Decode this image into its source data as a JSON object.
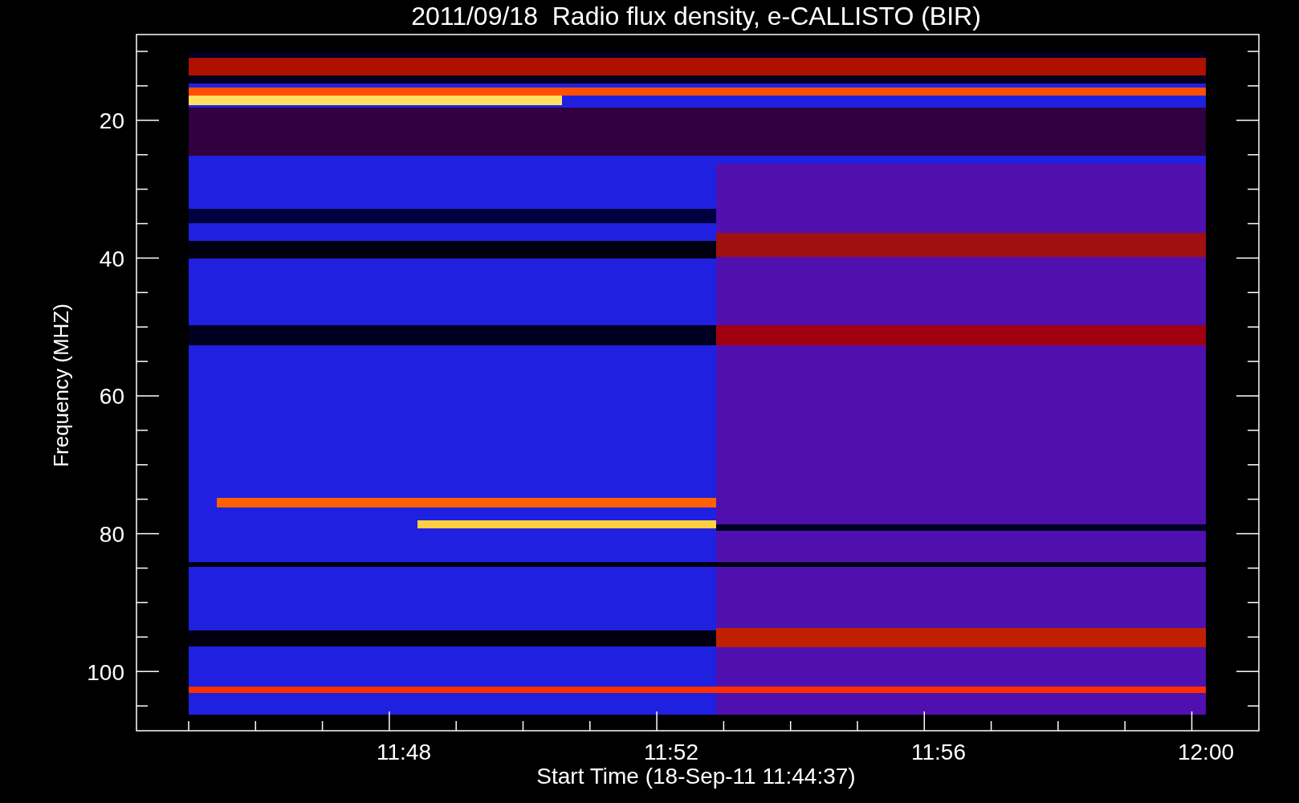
{
  "title": "2011/09/18  Radio flux density, e-CALLISTO (BIR)",
  "y_axis": {
    "label": "Frequency (MHZ)",
    "ticks": [
      "20",
      "40",
      "60",
      "80",
      "100"
    ]
  },
  "x_axis": {
    "label": "Start Time (18-Sep-11 11:44:37)",
    "ticks": [
      "11:48",
      "11:52",
      "11:56",
      "12:00"
    ]
  }
}
